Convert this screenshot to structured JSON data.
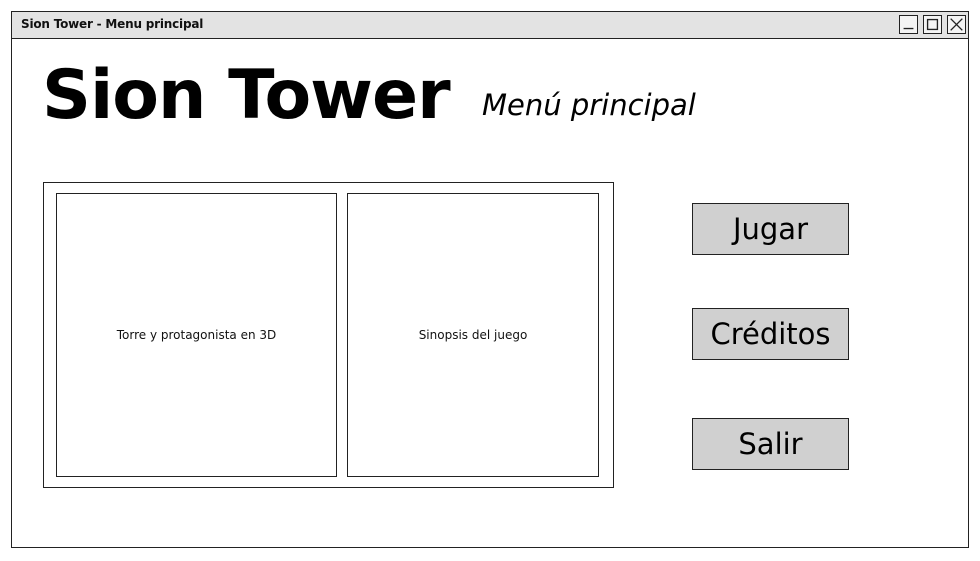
{
  "window": {
    "title": "Sion Tower - Menu principal"
  },
  "header": {
    "app_title": "Sion Tower",
    "subtitle": "Menú principal"
  },
  "panels": {
    "left_label": "Torre y protagonista en 3D",
    "right_label": "Sinopsis del juego"
  },
  "menu": {
    "play_label": "Jugar",
    "credits_label": "Créditos",
    "exit_label": "Salir"
  },
  "colors": {
    "button_fill": "#d0d0d0",
    "titlebar_fill": "#e3e3e3",
    "stroke": "#222222"
  },
  "icons": {
    "minimize": "minimize-icon",
    "maximize": "maximize-icon",
    "close": "close-icon"
  }
}
